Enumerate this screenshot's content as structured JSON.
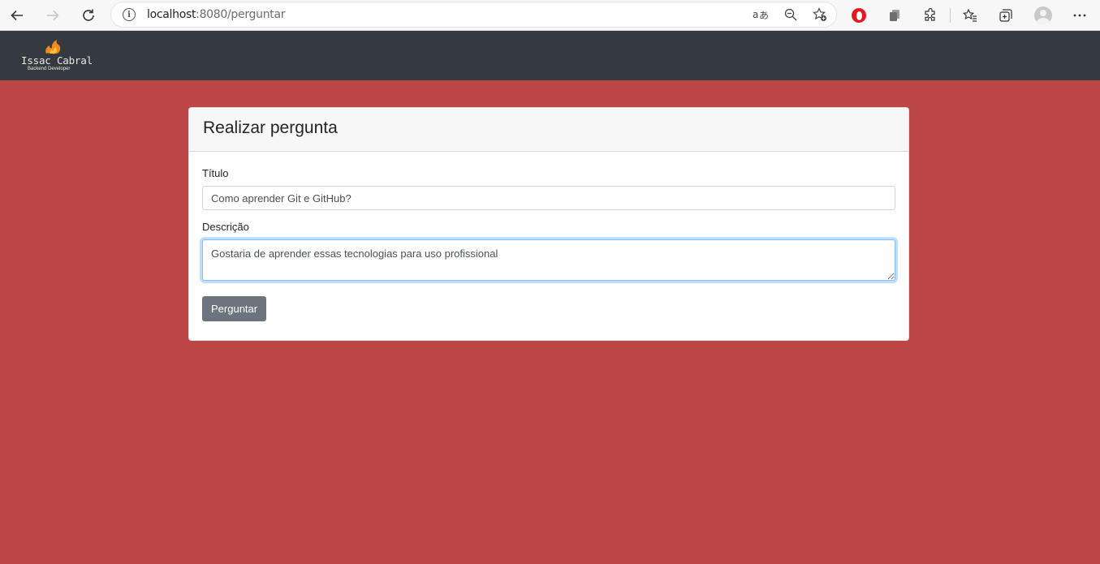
{
  "browser": {
    "url_host": "localhost",
    "url_path": ":8080/perguntar"
  },
  "navbar": {
    "logo_name": "Issac Cabral",
    "logo_subtitle": "Backend Developer"
  },
  "card": {
    "title": "Realizar pergunta",
    "title_field": {
      "label": "Título",
      "value": "Como aprender Git e GitHub?"
    },
    "description_field": {
      "label": "Descrição",
      "value": "Gostaria de aprender essas tecnologias para uso profissional"
    },
    "submit_label": "Perguntar"
  },
  "colors": {
    "page_background": "#bd4747",
    "navbar": "#343a40",
    "button": "#6c757d"
  }
}
